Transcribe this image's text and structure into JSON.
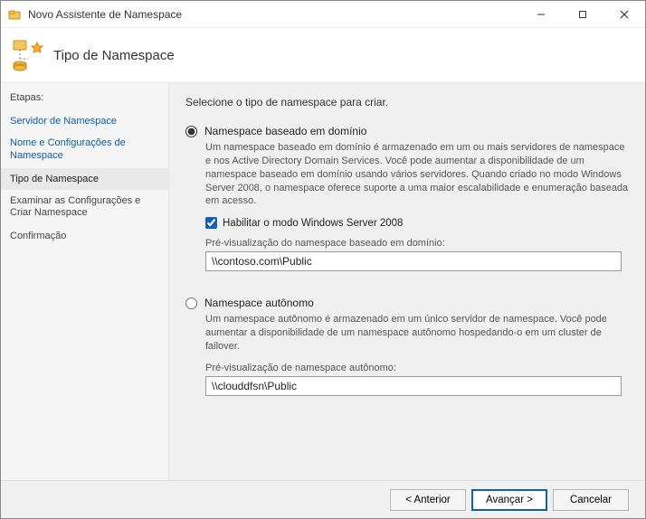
{
  "window": {
    "title": "Novo Assistente de Namespace"
  },
  "header": {
    "title": "Tipo de Namespace"
  },
  "sidebar": {
    "heading": "Etapas:",
    "steps": [
      "Servidor de Namespace",
      "Nome e Configurações de Namespace",
      "Tipo de Namespace",
      "Examinar as Configurações e Criar Namespace",
      "Confirmação"
    ]
  },
  "main": {
    "desc": "Selecione o tipo de namespace para criar.",
    "opt1": {
      "label": "Namespace baseado em domínio",
      "text": "Um namespace baseado em domínio é armazenado em um ou mais servidores de namespace e nos Active Directory Domain Services. Você pode aumentar a disponibilidade de um namespace baseado em domínio usando vários servidores. Quando criado no modo Windows Server 2008, o namespace oferece suporte a uma maior escalabilidade e enumeração baseada em acesso.",
      "checkbox": "Habilitar o modo Windows Server 2008",
      "previewLabel": "Pré-visualização do namespace baseado em domínio:",
      "previewValue": "\\\\contoso.com\\Public"
    },
    "opt2": {
      "label": "Namespace autônomo",
      "text": "Um namespace autônomo é armazenado em um único servidor de namespace. Você pode aumentar a disponibilidade de um namespace autônomo hospedando-o em um cluster de failover.",
      "previewLabel": "Pré-visualização de namespace autônomo:",
      "previewValue": "\\\\clouddfsn\\Public"
    }
  },
  "footer": {
    "back": "< Anterior",
    "next": "Avançar >",
    "cancel": "Cancelar"
  }
}
